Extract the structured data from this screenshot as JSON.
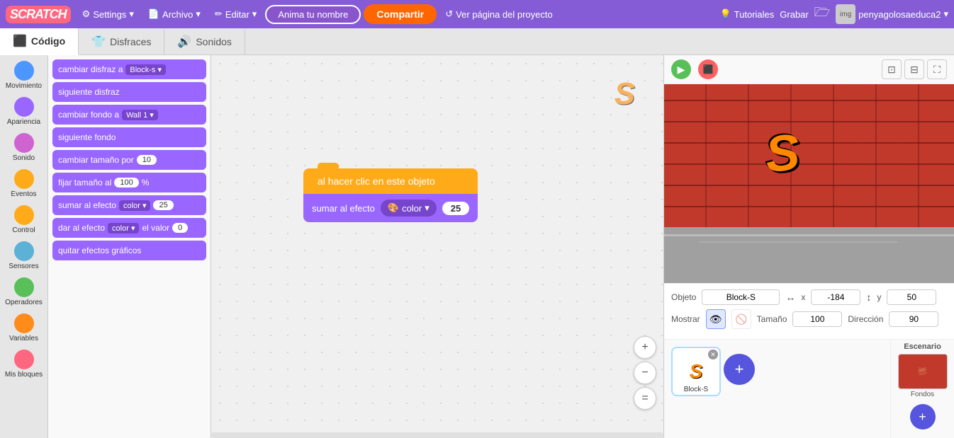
{
  "topnav": {
    "logo": "SCRATCH",
    "settings_label": "Settings",
    "archivo_label": "Archivo",
    "editar_label": "Editar",
    "anima_label": "Anima tu nombre",
    "compartir_label": "Compartir",
    "ver_label": "Ver página del proyecto",
    "tutoriales_label": "Tutoriales",
    "grabar_label": "Grabar",
    "user_label": "penyagolosaeduca2"
  },
  "tabs": {
    "codigo": "Código",
    "disfraces": "Disfraces",
    "sonidos": "Sonidos"
  },
  "sidebar": {
    "items": [
      {
        "label": "Movimiento",
        "color": "#4C97FF"
      },
      {
        "label": "Apariencia",
        "color": "#9966FF"
      },
      {
        "label": "Sonido",
        "color": "#CF63CF"
      },
      {
        "label": "Eventos",
        "color": "#FFAB19"
      },
      {
        "label": "Control",
        "color": "#FFAB19"
      },
      {
        "label": "Sensores",
        "color": "#5CB1D6"
      },
      {
        "label": "Operadores",
        "color": "#59C059"
      },
      {
        "label": "Variables",
        "color": "#FF8C1A"
      },
      {
        "label": "Mis bloques",
        "color": "#FF6680"
      }
    ]
  },
  "blocks": [
    {
      "text": "cambiar disfraz a",
      "dropdown": "Block-s",
      "type": "purple"
    },
    {
      "text": "siguiente disfraz",
      "type": "purple"
    },
    {
      "text": "cambiar fondo a",
      "dropdown": "Wall 1",
      "type": "purple"
    },
    {
      "text": "siguiente fondo",
      "type": "purple"
    },
    {
      "text": "cambiar tamaño por",
      "value": "10",
      "type": "purple"
    },
    {
      "text": "fijar tamaño al",
      "value": "100",
      "suffix": "%",
      "type": "purple"
    },
    {
      "text": "sumar al efecto",
      "dropdown": "color",
      "value": "25",
      "type": "purple"
    },
    {
      "text": "dar al efecto",
      "dropdown": "color",
      "suffix": "el valor",
      "value": "0",
      "type": "purple"
    },
    {
      "text": "quitar efectos gráficos",
      "type": "purple"
    }
  ],
  "script": {
    "hat_block": "al hacer clic en este objeto",
    "body_block": "sumar al efecto",
    "dropdown_value": "color",
    "number_value": "25"
  },
  "stage": {
    "sprite_name": "Block-S",
    "x_label": "x",
    "x_value": "-184",
    "y_label": "y",
    "y_value": "50",
    "mostrar_label": "Mostrar",
    "tamano_label": "Tamaño",
    "tamano_value": "100",
    "direccion_label": "Dirección",
    "direccion_value": "90",
    "objeto_label": "Objeto",
    "escenario_label": "Escenario",
    "fondos_label": "Fondos"
  },
  "zoom": {
    "in_icon": "+",
    "out_icon": "−",
    "fit_icon": "="
  }
}
